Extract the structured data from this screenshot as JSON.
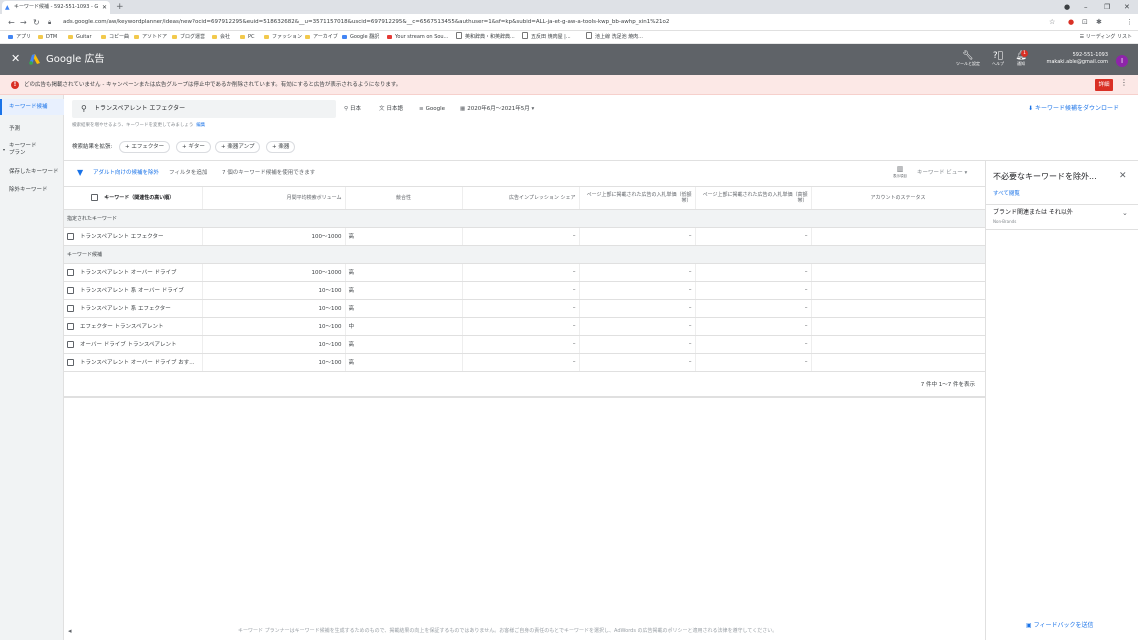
{
  "browser": {
    "tab_title": "キーワード候補 - 592-551-1093 - G",
    "url": "ads.google.com/aw/keywordplanner/ideas/new?ocid=697912295&euid=518632682&__u=3571157018&uscid=697912295&__c=6567513455&authuser=1&sf=kp&subid=ALL-ja-et-g-aw-a-tools-kwp_bb-awhp_xin1%21o2",
    "bookmarks": [
      "アプリ",
      "DTM",
      "Guitar",
      "コピー曲",
      "アソトドア",
      "ブログ運営",
      "会社",
      "PC",
      "ファッション",
      "アーカイブ",
      "Google 翻訳",
      "Your stream on Sou...",
      "英和辞典・和英辞典...",
      "五反田 焼肉屋 |...",
      "池上線 洗足池 焼肉..."
    ],
    "reading_list": "リーディング リスト"
  },
  "header": {
    "brand": "Google 広告",
    "tools_label": "ツールと設定",
    "help_label": "ヘルプ",
    "notif_label": "通知",
    "notif_count": "1",
    "account_id": "592-551-1093",
    "email": "makaki.able@gmail.com",
    "avatar_letter": "I"
  },
  "alert": {
    "text": "どの広告も掲載されていません - キャンペーンまたは広告グループは停止中であるか削除されています。有効にすると広告が表示されるようになります。",
    "button": "詳細"
  },
  "sidenav": {
    "items": [
      "キーワード候補",
      "予測",
      "キーワード プラン",
      "保存したキーワード",
      "除外キーワード"
    ]
  },
  "search": {
    "query": "トランスペアレント エフェクター",
    "location": "日本",
    "language": "日本語",
    "network": "Google",
    "date_range": "2020年6月～2021年5月",
    "hint": "検索結果を増やせるよう、キーワードを変更してみましょう",
    "hint_link": "編集",
    "download": "キーワード候補をダウンロード"
  },
  "expand": {
    "label": "検索結果を拡張:",
    "chips": [
      "エフェクター",
      "ギター",
      "楽器アンプ",
      "楽器"
    ]
  },
  "filterbar": {
    "adult": "アダルト向けの候補を除外",
    "add_filter": "フィルタを追加",
    "count_text": "7 個のキーワード候補を使用できます",
    "columns": "表示項目",
    "view": "キーワード ビュー"
  },
  "table": {
    "headers": [
      "キーワード（関連性の高い順）",
      "月間平均検索ボリューム",
      "競合性",
      "広告インプレッション シェア",
      "ページ上部に掲載された広告の入札単価（低額帯）",
      "ページ上部に掲載された広告の入札単価（高額帯）",
      "アカウントのステータス"
    ],
    "specified_label": "指定されたキーワード",
    "candidates_label": "キーワード候補",
    "specified": [
      {
        "kw": "トランスペアレント エフェクター",
        "vol": "100～1000",
        "comp": "高",
        "share": "–",
        "low": "–",
        "high": "–"
      }
    ],
    "candidates": [
      {
        "kw": "トランスペアレント オーバー ドライブ",
        "vol": "100～1000",
        "comp": "高",
        "share": "–",
        "low": "–",
        "high": "–"
      },
      {
        "kw": "トランスペアレント 系 オーバー ドライブ",
        "vol": "10～100",
        "comp": "高",
        "share": "–",
        "low": "–",
        "high": "–"
      },
      {
        "kw": "トランスペアレント 系 エフェクター",
        "vol": "10～100",
        "comp": "高",
        "share": "–",
        "low": "–",
        "high": "–"
      },
      {
        "kw": "エフェクター トランスペアレント",
        "vol": "10～100",
        "comp": "中",
        "share": "–",
        "low": "–",
        "high": "–"
      },
      {
        "kw": "オーバー ドライブ トランスペアレント",
        "vol": "10～100",
        "comp": "高",
        "share": "–",
        "low": "–",
        "high": "–"
      },
      {
        "kw": "トランスペアレント オーバー ドライブ おす...",
        "vol": "10～100",
        "comp": "高",
        "share": "–",
        "low": "–",
        "high": "–"
      }
    ],
    "pager": "7 件中 1～7 件を表示"
  },
  "right_panel": {
    "title": "不必要なキーワードを除外...",
    "all_view": "すべて閲覧",
    "item": "ブランド関連または それ以外",
    "item_sub": "Non-Brands"
  },
  "footer": {
    "text": "キーワード プランナーはキーワード候補を生成するためのもので、掲載結果の向上を保証するものではありません。お客様ご自身の責任のもとでキーワードを選択し、AdWords の広告掲載のポリシーと適用される法律を遵守してください。",
    "feedback": "フィードバックを送信"
  }
}
